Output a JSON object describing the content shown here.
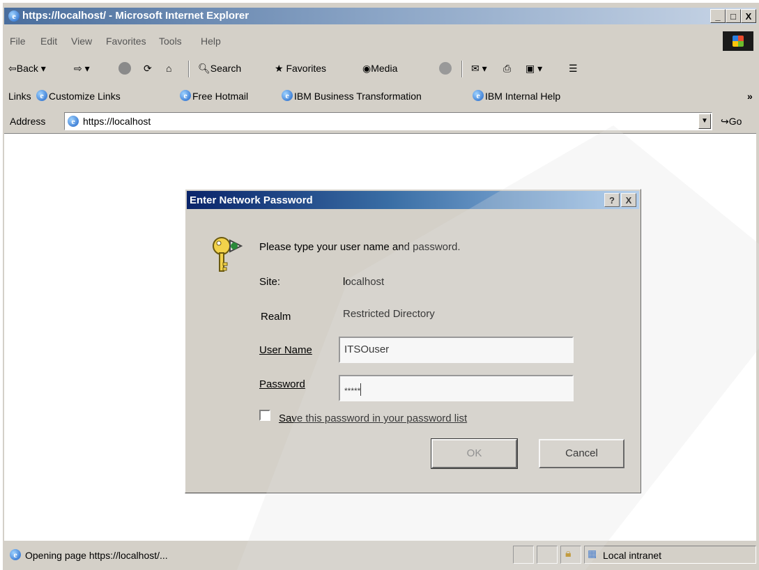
{
  "browser": {
    "title": "https://localhost/ - Microsoft Internet Explorer",
    "window_buttons": [
      "_",
      "□",
      "X"
    ],
    "menu": [
      "File",
      "Edit",
      "View",
      "Favorites",
      "Tools",
      "Help"
    ],
    "toolbar": {
      "back": "Back",
      "search": "Search",
      "favorites": "Favorites",
      "media": "Media"
    },
    "links": {
      "label": "Links",
      "items": [
        "Customize Links",
        "Free Hotmail",
        "IBM Business Transformation",
        "IBM Internal Help"
      ],
      "chevron": "»"
    },
    "address": {
      "label": "Address",
      "value": "https://localhost",
      "go": "Go"
    },
    "status": {
      "text": "Opening page https://localhost/...",
      "zone": "Local intranet"
    }
  },
  "dialog": {
    "title": "Enter Network Password",
    "help_btn": "?",
    "close_btn": "X",
    "prompt": "Please type your user name and password.",
    "site_label": "Site:",
    "site_value": "localhost",
    "realm_label": "Realm",
    "realm_value": "Restricted Directory",
    "username_label": "User Name",
    "username_value": "ITSOuser",
    "password_label": "Password",
    "password_value": "*****",
    "save_label": "Save this password in your password list",
    "save_checked": false,
    "ok": "OK",
    "cancel": "Cancel"
  }
}
